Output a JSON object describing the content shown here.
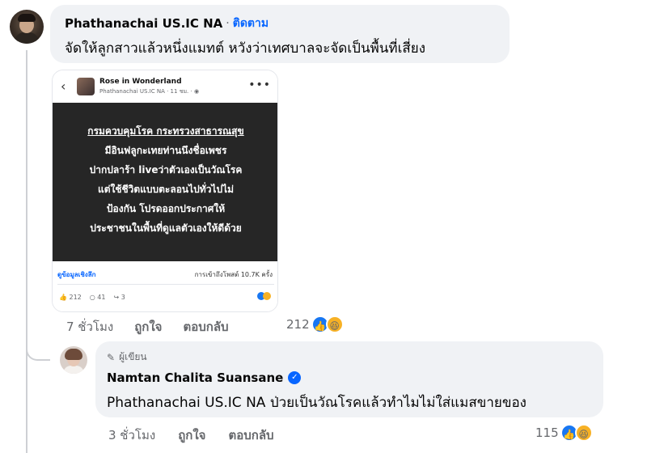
{
  "comment": {
    "author": "Phathanachai US.IC NA",
    "separator": "·",
    "follow_label": "ติดตาม",
    "text": "จัดให้ลูกสาวแล้วหนึ่งแมทต์ หวังว่าเทศบาลจะจัดเป็นพื้นที่เสี่ยง",
    "time": "7 ชั่วโมง",
    "like_label": "ถูกใจ",
    "reply_label": "ตอบกลับ",
    "reaction_count": "212"
  },
  "screenshot": {
    "back": "‹",
    "page_name": "Rose in Wonderland",
    "meta": "Phathanachai US.IC NA · 11 ชม. · ◉",
    "more": "•••",
    "lines": [
      "กรมควบคุมโรค กระทรวงสาธารณสุข",
      "มีอินฟลูกะเทยท่านนึงชื่อเพชร",
      "ปากปลาร้า liveว่าตัวเองเป็นวัณโรค",
      "แต่ใช้ชีวิตแบบตะลอนไปทั่วไปไม่",
      "ป้องกัน โปรดออกประกาศให้",
      "ประชาชนในพื้นที่ดูแลตัวเองให้ดีด้วย"
    ],
    "link": "ดูข้อมูลเชิงลึก",
    "views": "การเข้าถึงโพสต์ 10.7K ครั้ง",
    "likes": "👍 212",
    "comments": "○ 41",
    "shares": "↪ 3"
  },
  "reply": {
    "badge_icon": "✎",
    "badge": "ผู้เขียน",
    "author": "Namtan Chalita Suansane",
    "verified": "✓",
    "text": "Phathanachai US.IC NA ป่วยเป็นวัณโรคแล้วทำไมไม่ใส่แมสขายของ",
    "time": "3 ชั่วโมง",
    "like_label": "ถูกใจ",
    "reply_label": "ตอบกลับ",
    "reaction_count": "115"
  },
  "reaction_icons": {
    "like": "👍",
    "haha": "😆"
  },
  "colors": {
    "accent": "#0866ff",
    "bubble": "#f0f2f5",
    "muted": "#65676b"
  }
}
